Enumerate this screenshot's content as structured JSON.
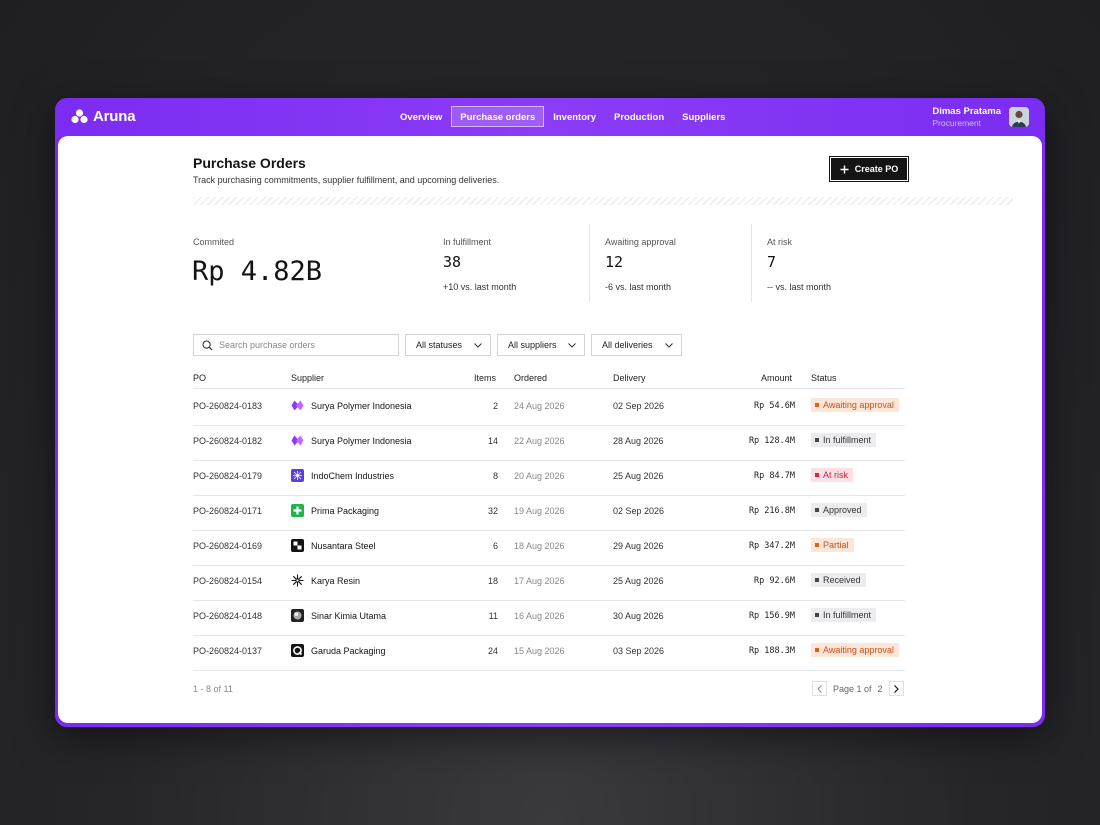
{
  "app": {
    "name": "Aruna"
  },
  "nav": {
    "items": [
      {
        "label": "Overview",
        "active": false
      },
      {
        "label": "Purchase orders",
        "active": true
      },
      {
        "label": "Inventory",
        "active": false
      },
      {
        "label": "Production",
        "active": false
      },
      {
        "label": "Suppliers",
        "active": false
      }
    ]
  },
  "user": {
    "name": "Dimas Pratama",
    "role": "Procurement"
  },
  "page": {
    "title": "Purchase Orders",
    "subtitle": "Track purchasing commitments, supplier fulfillment, and upcoming deliveries.",
    "create_label": "Create PO"
  },
  "stats": {
    "commited": {
      "label": "Commited",
      "value": "Rp 4.82B"
    },
    "in_fulfillment": {
      "label": "In fulfillment",
      "value": "38",
      "delta": "+10 vs. last month"
    },
    "awaiting": {
      "label": "Awaiting approval",
      "value": "12",
      "delta": "-6 vs. last month"
    },
    "at_risk": {
      "label": "At risk",
      "value": "7",
      "delta": "-- vs. last month"
    }
  },
  "filters": {
    "search_placeholder": "Search purchase orders",
    "status": "All statuses",
    "suppliers": "All suppliers",
    "deliveries": "All deliveries"
  },
  "table": {
    "headers": {
      "po": "PO",
      "supplier": "Supplier",
      "items": "Items",
      "ordered": "Ordered",
      "delivery": "Delivery",
      "amount": "Amount",
      "status": "Status"
    },
    "rows": [
      {
        "po": "PO-260824-0183",
        "supplier": "Surya Polymer Indonesia",
        "logo": "surya-logo",
        "items": "2",
        "ordered": "24 Aug 2026",
        "delivery": "02 Sep 2026",
        "amount": "Rp 54.6M",
        "status": "Awaiting approval",
        "kind": "await"
      },
      {
        "po": "PO-260824-0182",
        "supplier": "Surya Polymer Indonesia",
        "logo": "surya-logo",
        "items": "14",
        "ordered": "22 Aug 2026",
        "delivery": "28 Aug 2026",
        "amount": "Rp 128.4M",
        "status": "In fulfillment",
        "kind": "ful"
      },
      {
        "po": "PO-260824-0179",
        "supplier": "IndoChem Industries",
        "logo": "indochem-logo",
        "items": "8",
        "ordered": "20 Aug 2026",
        "delivery": "25 Aug 2026",
        "amount": "Rp 84.7M",
        "status": "At risk",
        "kind": "risk"
      },
      {
        "po": "PO-260824-0171",
        "supplier": "Prima Packaging",
        "logo": "prima-logo",
        "items": "32",
        "ordered": "19 Aug 2026",
        "delivery": "02 Sep 2026",
        "amount": "Rp 216.8M",
        "status": "Approved",
        "kind": "appr"
      },
      {
        "po": "PO-260824-0169",
        "supplier": "Nusantara Steel",
        "logo": "nusantara-logo",
        "items": "6",
        "ordered": "18 Aug 2026",
        "delivery": "29 Aug 2026",
        "amount": "Rp 347.2M",
        "status": "Partial",
        "kind": "part"
      },
      {
        "po": "PO-260824-0154",
        "supplier": "Karya Resin",
        "logo": "karya-logo",
        "items": "18",
        "ordered": "17 Aug 2026",
        "delivery": "25 Aug 2026",
        "amount": "Rp 92.6M",
        "status": "Received",
        "kind": "rec"
      },
      {
        "po": "PO-260824-0148",
        "supplier": "Sinar Kimia Utama",
        "logo": "sinar-logo",
        "items": "11",
        "ordered": "16 Aug 2026",
        "delivery": "30 Aug 2026",
        "amount": "Rp 156.9M",
        "status": "In fulfillment",
        "kind": "ful"
      },
      {
        "po": "PO-260824-0137",
        "supplier": "Garuda Packaging",
        "logo": "garuda-logo",
        "items": "24",
        "ordered": "15 Aug 2026",
        "delivery": "03 Sep 2026",
        "amount": "Rp 188.3M",
        "status": "Awaiting approval",
        "kind": "await"
      }
    ]
  },
  "footer": {
    "count": "1 - 8 of 11",
    "page_label": "Page 1 of",
    "total_pages": "2"
  },
  "colors": {
    "brand": "#8b3cf7",
    "dark": "#141414",
    "warn": "#e0601e",
    "danger": "#e0243e"
  }
}
